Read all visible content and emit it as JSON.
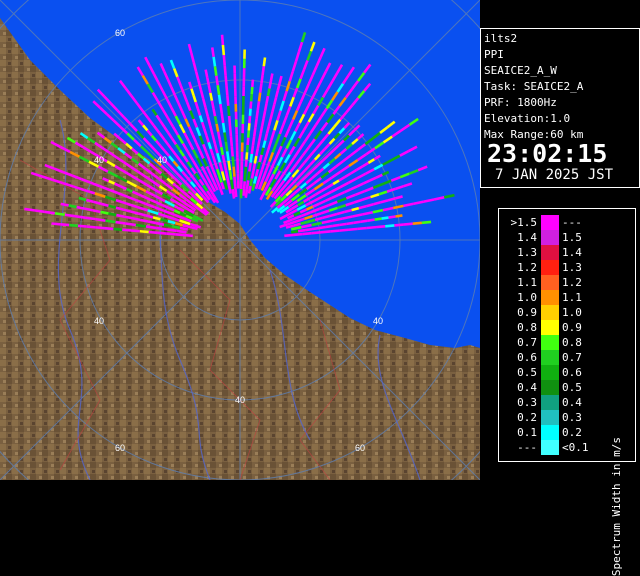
{
  "radar": {
    "site": "ilts2",
    "product": "PPI",
    "task_line": "SEAICE2_A_W",
    "task_label": "Task: SEAICE2_A",
    "prf": "PRF: 1800Hz",
    "elevation": "Elevation:1.0",
    "max_range": "Max Range:60 km",
    "time": "23:02:15",
    "date": "7 JAN 2025 JST"
  },
  "map": {
    "range_labels": [
      {
        "text": "60",
        "ring": "upper-left"
      },
      {
        "text": "40",
        "ring": "upper-left"
      },
      {
        "text": "40",
        "ring": "left"
      },
      {
        "text": "40",
        "ring": "right"
      },
      {
        "text": "40",
        "ring": "bottom"
      },
      {
        "text": "60",
        "ring": "bottom-left"
      },
      {
        "text": "60",
        "ring": "bottom-right"
      }
    ],
    "colors": {
      "sea": "#0a50f0",
      "land": "#7a6040",
      "ring": "#6b7fa0"
    }
  },
  "legend": {
    "title": "Spectrum Width in m/s",
    "rows": [
      {
        "left": ">1.5",
        "right": "---",
        "color": "#ff00ff"
      },
      {
        "left": "1.4",
        "right": "1.5",
        "color": "#d020e0"
      },
      {
        "left": "1.3",
        "right": "1.4",
        "color": "#e01040"
      },
      {
        "left": "1.2",
        "right": "1.3",
        "color": "#ff2010"
      },
      {
        "left": "1.1",
        "right": "1.2",
        "color": "#ff6020"
      },
      {
        "left": "1.0",
        "right": "1.1",
        "color": "#ff9000"
      },
      {
        "left": "0.9",
        "right": "1.0",
        "color": "#ffd000"
      },
      {
        "left": "0.8",
        "right": "0.9",
        "color": "#ffff00"
      },
      {
        "left": "0.7",
        "right": "0.8",
        "color": "#40ff10"
      },
      {
        "left": "0.6",
        "right": "0.7",
        "color": "#20d020"
      },
      {
        "left": "0.5",
        "right": "0.6",
        "color": "#10b010"
      },
      {
        "left": "0.4",
        "right": "0.5",
        "color": "#109010"
      },
      {
        "left": "0.3",
        "right": "0.4",
        "color": "#10a080"
      },
      {
        "left": "0.2",
        "right": "0.3",
        "color": "#20c0c0"
      },
      {
        "left": "0.1",
        "right": "0.2",
        "color": "#00ffff"
      },
      {
        "left": "---",
        "right": "<0.1",
        "color": "#40ffff"
      }
    ]
  }
}
